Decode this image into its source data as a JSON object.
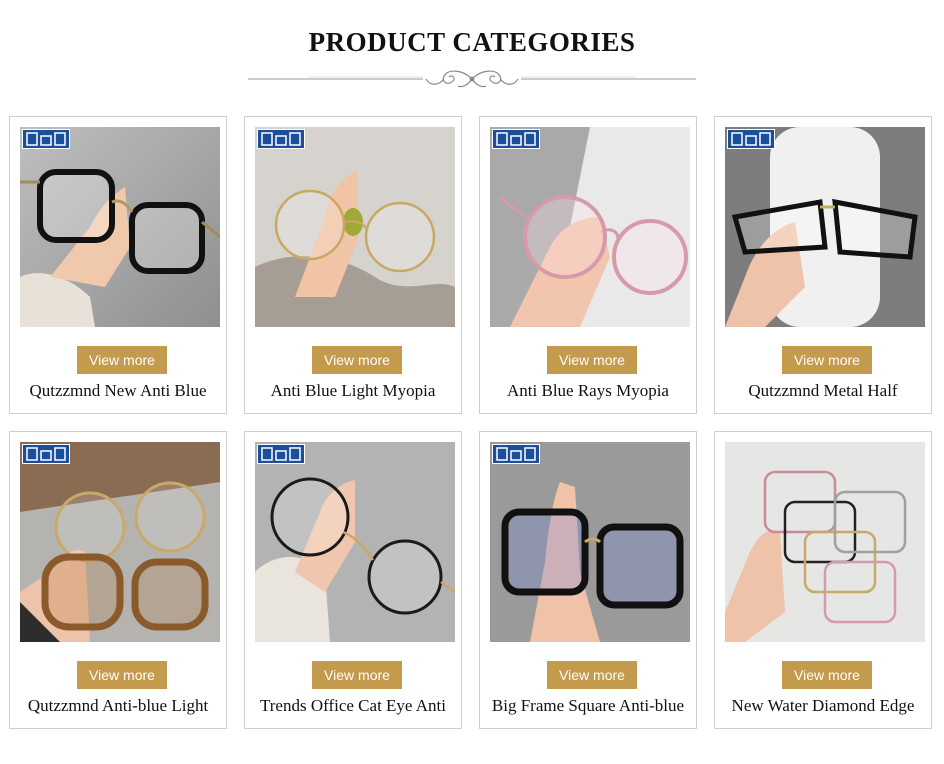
{
  "section": {
    "title": "PRODUCT CATEGORIES"
  },
  "colors": {
    "button": "#c49a4c",
    "badge": "#1b4f9c",
    "border": "#cfcfcf"
  },
  "cards": [
    {
      "name": "Qutzzmnd New Anti Blue",
      "button_label": "View more",
      "photo": "hand holding black square glasses frame",
      "badge_icon": "brand-logo-icon"
    },
    {
      "name": "Anti Blue Light Myopia",
      "button_label": "View more",
      "photo": "hand holding gold round wire glasses",
      "badge_icon": "brand-logo-icon"
    },
    {
      "name": "Anti Blue Rays Myopia",
      "button_label": "View more",
      "photo": "hand holding pink round glasses",
      "badge_icon": "brand-logo-icon"
    },
    {
      "name": "Qutzzmnd Metal Half",
      "button_label": "View more",
      "photo": "hand holding black half-rim glasses with white case",
      "badge_icon": "brand-logo-icon"
    },
    {
      "name": "Qutzzmnd Anti-blue Light",
      "button_label": "View more",
      "photo": "hand holding gold and tortoise glasses",
      "badge_icon": "brand-logo-icon"
    },
    {
      "name": "Trends Office Cat Eye Anti",
      "button_label": "View more",
      "photo": "hand holding thin black round glasses",
      "badge_icon": "brand-logo-icon"
    },
    {
      "name": "Big Frame Square Anti-blue",
      "button_label": "View more",
      "photo": "hand holding large black square glasses",
      "badge_icon": "brand-logo-icon"
    },
    {
      "name": "New Water Diamond Edge",
      "button_label": "View more",
      "photo": "hand holding stack of multicolor glasses",
      "badge_icon": "none"
    }
  ]
}
